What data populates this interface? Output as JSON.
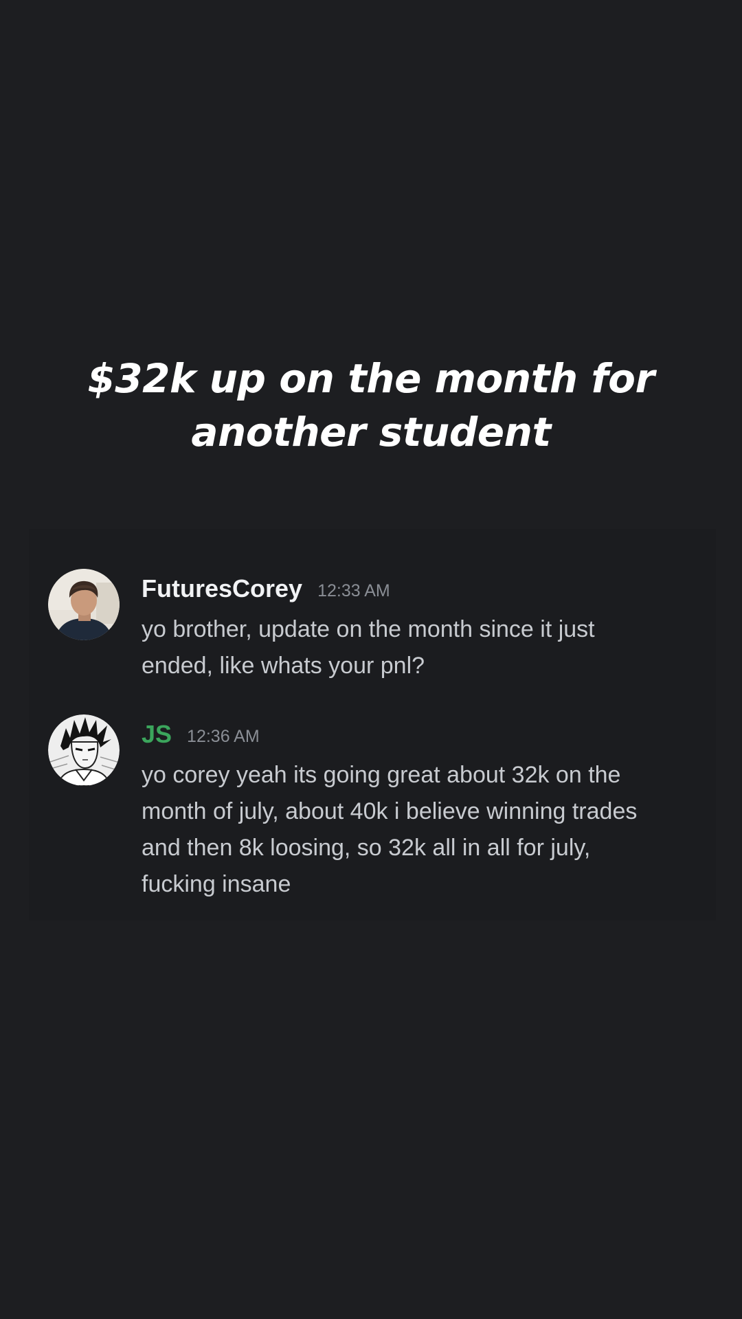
{
  "caption": {
    "line1": "$32k up on the month for",
    "line2": "another student"
  },
  "messages": [
    {
      "username": "FuturesCorey",
      "timestamp": "12:33 AM",
      "username_color": "#f2f3f5",
      "avatar": "user-photo-avatar",
      "lines": [
        "yo brother, update on the month since it just",
        "ended, like whats your pnl?"
      ]
    },
    {
      "username": "JS",
      "timestamp": "12:36 AM",
      "username_color": "#3ba55c",
      "avatar": "anime-sketch-avatar",
      "lines": [
        "yo corey yeah its going great about 32k on the",
        "month of july, about 40k i believe winning trades",
        "and then 8k loosing, so 32k all in all for july,",
        "fucking insane"
      ]
    }
  ],
  "colors": {
    "background": "#1d1e21",
    "caption_text": "#ffffff",
    "message_text": "#c8cbd0",
    "timestamp": "#8a8e95"
  }
}
